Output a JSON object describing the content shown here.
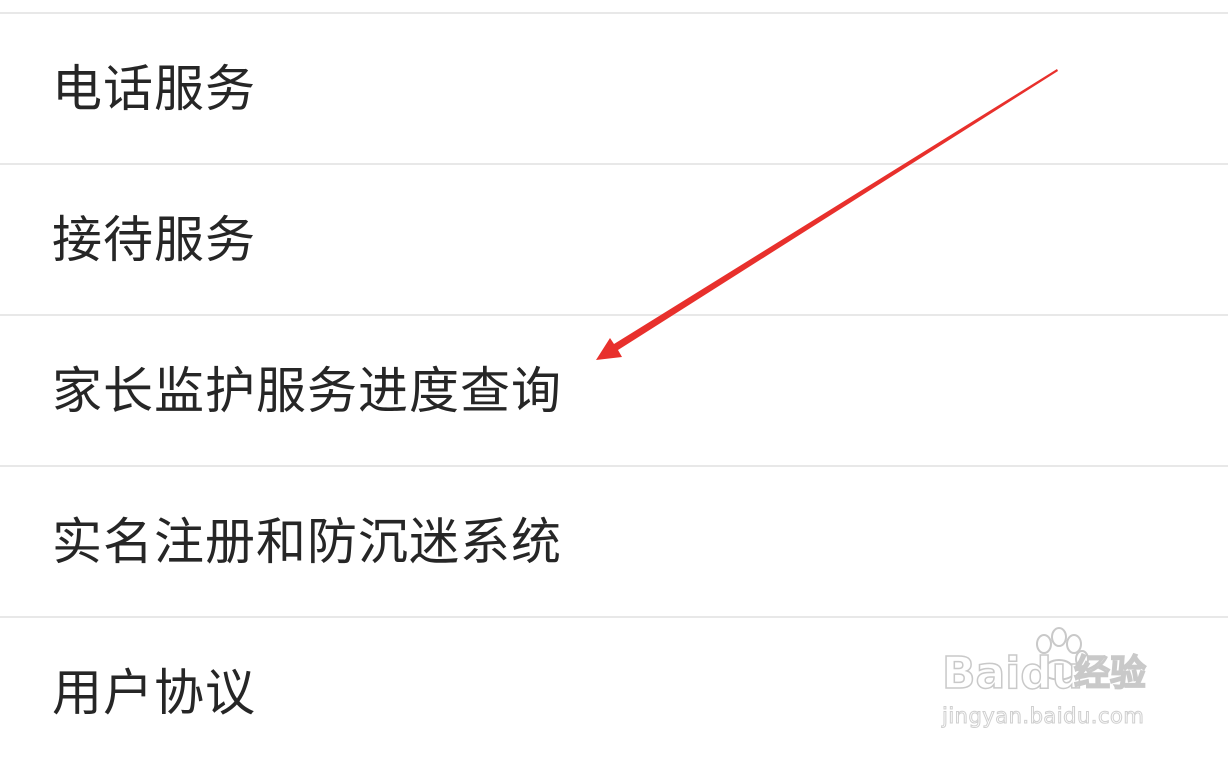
{
  "menu": {
    "items": [
      {
        "label": "电话服务"
      },
      {
        "label": "接待服务"
      },
      {
        "label": "家长监护服务进度查询"
      },
      {
        "label": "实名注册和防沉迷系统"
      },
      {
        "label": "用户协议"
      }
    ]
  },
  "watermark": {
    "brand": "Baidu",
    "product": "经验",
    "url": "jingyan.baidu.com"
  },
  "colors": {
    "annotation_arrow": "#e8302c",
    "divider": "#e8e8e8",
    "text": "#262626"
  }
}
